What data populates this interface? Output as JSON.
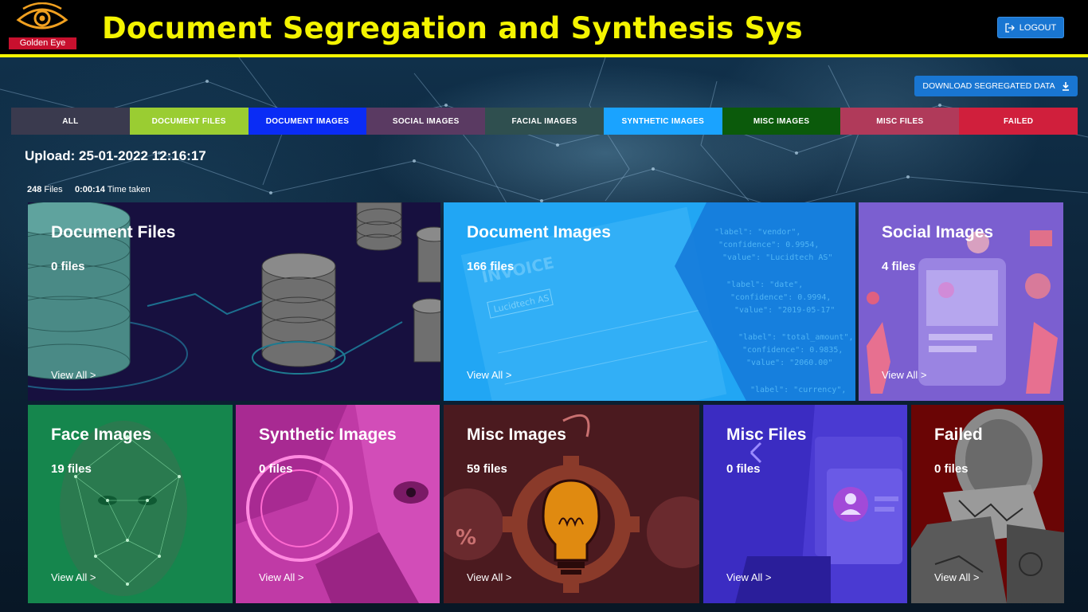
{
  "header": {
    "logo_text": "Golden Eye",
    "title": "Document Segregation and Synthesis Sys",
    "logout_label": "LOGOUT"
  },
  "toolbar": {
    "download_label": "DOWNLOAD SEGREGATED DATA"
  },
  "tabs": [
    {
      "label": "ALL",
      "bg": "#3a3a4e",
      "color": "#ffffff"
    },
    {
      "label": "DOCUMENT FILES",
      "bg": "#9acd32",
      "color": "#ffffff"
    },
    {
      "label": "DOCUMENT IMAGES",
      "bg": "#0a2cf5",
      "color": "#ffffff"
    },
    {
      "label": "SOCIAL IMAGES",
      "bg": "#5a3a62",
      "color": "#ffffff"
    },
    {
      "label": "FACIAL IMAGES",
      "bg": "#2f4f4f",
      "color": "#ffffff"
    },
    {
      "label": "SYNTHETIC IMAGES",
      "bg": "#1aa3ff",
      "color": "#ffffff"
    },
    {
      "label": "MISC IMAGES",
      "bg": "#0b5a0b",
      "color": "#ffffff"
    },
    {
      "label": "MISC FILES",
      "bg": "#b03a5a",
      "color": "#ffffff"
    },
    {
      "label": "FAILED",
      "bg": "#d01f3c",
      "color": "#ffffff"
    }
  ],
  "upload": {
    "title": "Upload: 25-01-2022 12:16:17",
    "files_count": "248",
    "files_label": "Files",
    "time_value": "0:00:14",
    "time_label": "Time taken"
  },
  "cards": [
    {
      "title": "Document Files",
      "count": "0 files",
      "link": "View All >"
    },
    {
      "title": "Document Images",
      "count": "166 files",
      "link": "View All >"
    },
    {
      "title": "Social Images",
      "count": "4 files",
      "link": "View All >"
    },
    {
      "title": "Face Images",
      "count": "19 files",
      "link": "View All >"
    },
    {
      "title": "Synthetic Images",
      "count": "0 files",
      "link": "View All >"
    },
    {
      "title": "Misc Images",
      "count": "59 files",
      "link": "View All >"
    },
    {
      "title": "Misc Files",
      "count": "0 files",
      "link": "View All >"
    },
    {
      "title": "Failed",
      "count": "0 files",
      "link": "View All >"
    }
  ],
  "doc_image_art": {
    "invoice_word": "INVOICE",
    "company": "Lucidtech AS",
    "json_lines": [
      "\"label\": \"vendor\",",
      "\"confidence\": 0.9954,",
      "\"value\": \"Lucidtech AS\"",
      "\"label\": \"date\",",
      "\"confidence\": 0.9994,",
      "\"value\": \"2019-05-17\"",
      "\"label\": \"total_amount\",",
      "\"confidence\": 0.9835,",
      "\"value\": \"2060.00\"",
      "\"label\": \"currency\","
    ]
  },
  "colors": {
    "accent_yellow": "#f4f400",
    "button_blue": "#1976d2"
  },
  "icons": {
    "logout": "logout-icon",
    "download": "download-icon",
    "logo": "eye-logo-icon"
  }
}
